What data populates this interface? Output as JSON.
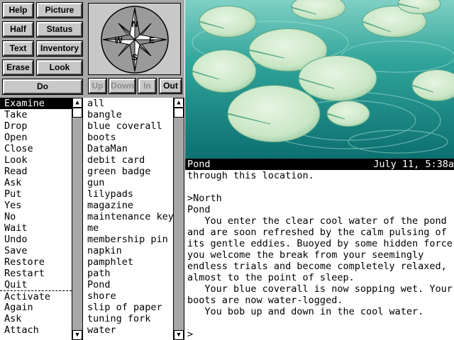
{
  "controls": {
    "buttons": [
      "Help",
      "Picture",
      "Half",
      "Status",
      "Text",
      "Inventory",
      "Erase",
      "Look",
      "Do"
    ],
    "compass_labels": {
      "n": "N",
      "e": "E",
      "s": "S",
      "w": "W"
    },
    "direction_buttons": [
      "Up",
      "Down",
      "In",
      "Out"
    ]
  },
  "verbs": [
    "Examine",
    "Take",
    "Drop",
    "Open",
    "Close",
    "Look",
    "Read",
    "Ask",
    "Put",
    "Yes",
    "No",
    "Wait",
    "Undo",
    "Save",
    "Restore",
    "Restart",
    "Quit",
    "Activate",
    "Again",
    "Ask",
    "Attach"
  ],
  "verbs_selected_index": 0,
  "verbs_separator_after_index": 16,
  "nouns": [
    "all",
    "bangle",
    "blue coverall",
    "boots",
    "DataMan",
    "debit card",
    "green badge",
    "gun",
    "lilypads",
    "magazine",
    "maintenance key",
    "me",
    "membership pin",
    "napkin",
    "pamphlet",
    "path",
    "Pond",
    "shore",
    "slip of paper",
    "tuning fork",
    "water"
  ],
  "status": {
    "location": "Pond",
    "datetime": "July 11, 5:38a"
  },
  "transcript": [
    "through this location.",
    "",
    ">North",
    "Pond",
    "   You enter the clear cool water of the pond",
    "and are soon refreshed by the calm pulsing of",
    "its gentle eddies. Buoyed by some hidden force,",
    "you welcome the break from your seemingly",
    "endless trials and become completely relaxed,",
    "almost to the point of sleep.",
    "   Your blue coverall is now sopping wet. Your",
    "boots are now water-logged.",
    "   You bob up and down in the cool water.",
    "",
    ">"
  ],
  "colors": {
    "water": "#2fa39a",
    "lilypad": "#c9e6c4",
    "panel": "#a8a8a8"
  }
}
